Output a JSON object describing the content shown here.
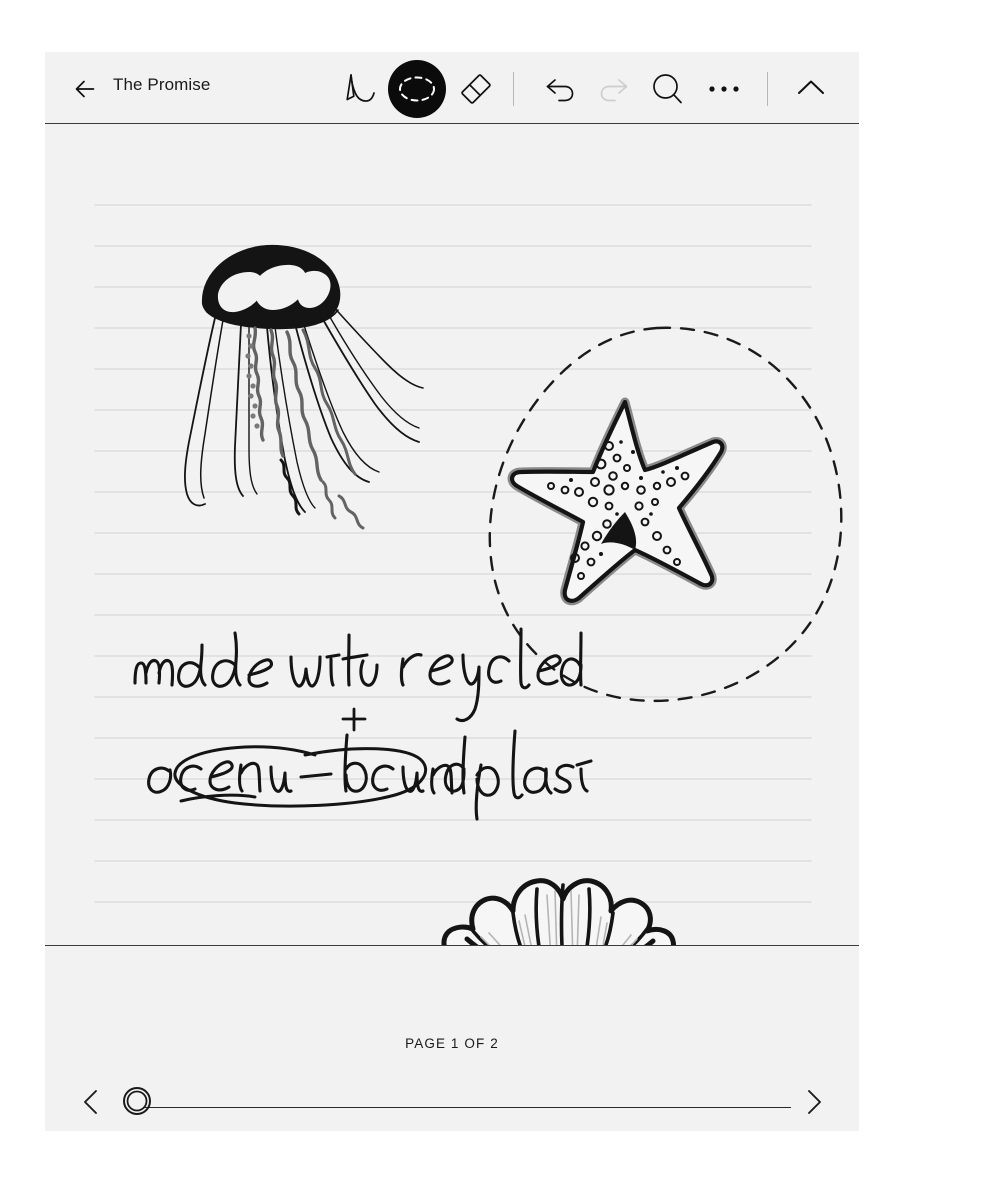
{
  "window": {
    "background": "#ffffff",
    "panel_background": "#f2f2f2"
  },
  "header": {
    "back_icon": "arrow-left-icon",
    "title": "The Promise",
    "tools": [
      {
        "name": "pen-tool",
        "icon": "pen-icon",
        "selected": false,
        "enabled": true
      },
      {
        "name": "select-tool",
        "icon": "lasso-select-icon",
        "selected": true,
        "enabled": true
      },
      {
        "name": "eraser-tool",
        "icon": "eraser-icon",
        "selected": false,
        "enabled": true
      },
      {
        "name": "undo-button",
        "icon": "undo-arrow-icon",
        "selected": false,
        "enabled": true
      },
      {
        "name": "redo-button",
        "icon": "redo-arrow-icon",
        "selected": false,
        "enabled": false
      },
      {
        "name": "search-button",
        "icon": "search-icon",
        "selected": false,
        "enabled": true
      },
      {
        "name": "more-button",
        "icon": "ellipsis-icon",
        "selected": false,
        "enabled": true
      },
      {
        "name": "collapse-button",
        "icon": "chevron-up-icon",
        "selected": false,
        "enabled": true
      }
    ],
    "selected_tool_fill": "#0b0b0b",
    "disabled_color": "#cccccc"
  },
  "canvas": {
    "paper_style": "ruled",
    "rule_color": "#dcdcdc",
    "rule_count": 19,
    "rule_spacing_px": 41,
    "ink_color": "#141414",
    "selection": {
      "type": "lasso",
      "target": "starfish-drawing",
      "stroke": "dashed",
      "stroke_color": "#1a1a1a"
    },
    "drawings": [
      {
        "name": "jellyfish-drawing",
        "label": "jellyfish sketch"
      },
      {
        "name": "starfish-drawing",
        "label": "starfish sketch"
      },
      {
        "name": "seashell-drawing",
        "label": "scallop shell sketch"
      }
    ],
    "handwriting": {
      "line_1": "made with recycled",
      "line_2": "+",
      "line_3_circled": "ocean-bound",
      "line_3_rest": "plastic!"
    }
  },
  "footer": {
    "page_label": "PAGE 1 OF 2",
    "prev_icon": "chevron-left-icon",
    "next_icon": "chevron-right-icon",
    "slider": {
      "name": "page-slider",
      "value": 1,
      "min": 1,
      "max": 2,
      "handle_position_percent": 0
    }
  }
}
